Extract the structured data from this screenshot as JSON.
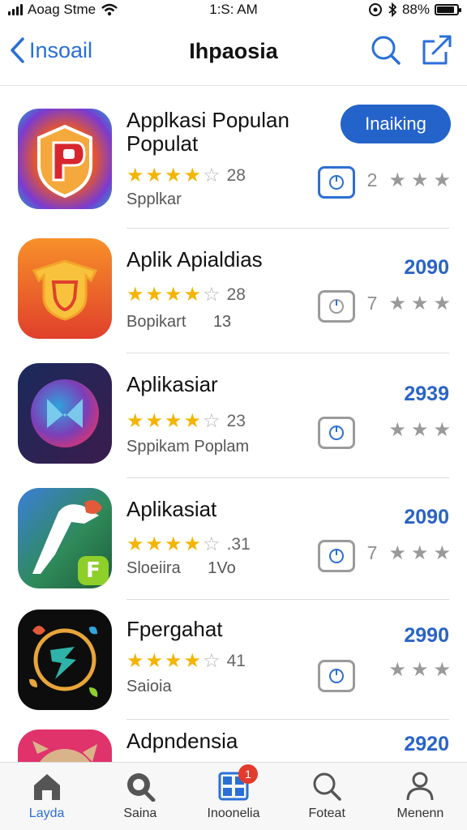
{
  "status_bar": {
    "carrier": "Aoag Stme",
    "time": "1:S: AM",
    "battery": "88%",
    "battery_level": 0.88
  },
  "nav": {
    "back_label": "Insoail",
    "title": "Ihpaosia",
    "icons": [
      "search-icon",
      "share-icon"
    ]
  },
  "apps": [
    {
      "name_line1": "Applkasi Populan",
      "name_line2": "Populat",
      "rating_count": "28",
      "subtitle": "Spplkar",
      "subtitle_extra": "",
      "action_label": "Inaiking",
      "price": "",
      "mini_num": "2",
      "stars": 4.5
    },
    {
      "name_line1": "Aplik Apialdias",
      "name_line2": "",
      "rating_count": "28",
      "subtitle": "Bopikart",
      "subtitle_extra": "13",
      "action_label": "",
      "price": "2090",
      "mini_num": "7",
      "stars": 4.5
    },
    {
      "name_line1": "Aplikasiar",
      "name_line2": "",
      "rating_count": "23",
      "subtitle": "Sppikam Poplam",
      "subtitle_extra": "",
      "action_label": "",
      "price": "2939",
      "mini_num": "",
      "stars": 4.5
    },
    {
      "name_line1": "Aplikasiat",
      "name_line2": "",
      "rating_count": ".31",
      "subtitle": "Sloeiira",
      "subtitle_extra": "1Vo",
      "action_label": "",
      "price": "2090",
      "mini_num": "7",
      "stars": 4.5
    },
    {
      "name_line1": "Fpergahat",
      "name_line2": "",
      "rating_count": "41",
      "subtitle": "Saioia",
      "subtitle_extra": "",
      "action_label": "",
      "price": "2990",
      "mini_num": "",
      "stars": 4.5
    },
    {
      "name_line1": "Adpndensia",
      "name_line2": "",
      "rating_count": "",
      "subtitle": "",
      "subtitle_extra": "",
      "action_label": "",
      "price": "2920",
      "mini_num": "",
      "stars": 4.5
    }
  ],
  "tabs": [
    {
      "label": "Layda",
      "icon": "home-icon",
      "active": true
    },
    {
      "label": "Saina",
      "icon": "search-icon",
      "active": false
    },
    {
      "label": "Inoonelia",
      "icon": "apps-icon",
      "active": false,
      "badge": "1"
    },
    {
      "label": "Foteat",
      "icon": "search-icon",
      "active": false
    },
    {
      "label": "Menenn",
      "icon": "person-icon",
      "active": false
    }
  ],
  "colors": {
    "accent": "#2a6fd6",
    "button": "#2463c9",
    "star": "#f4b400",
    "badge": "#e23a2d"
  }
}
